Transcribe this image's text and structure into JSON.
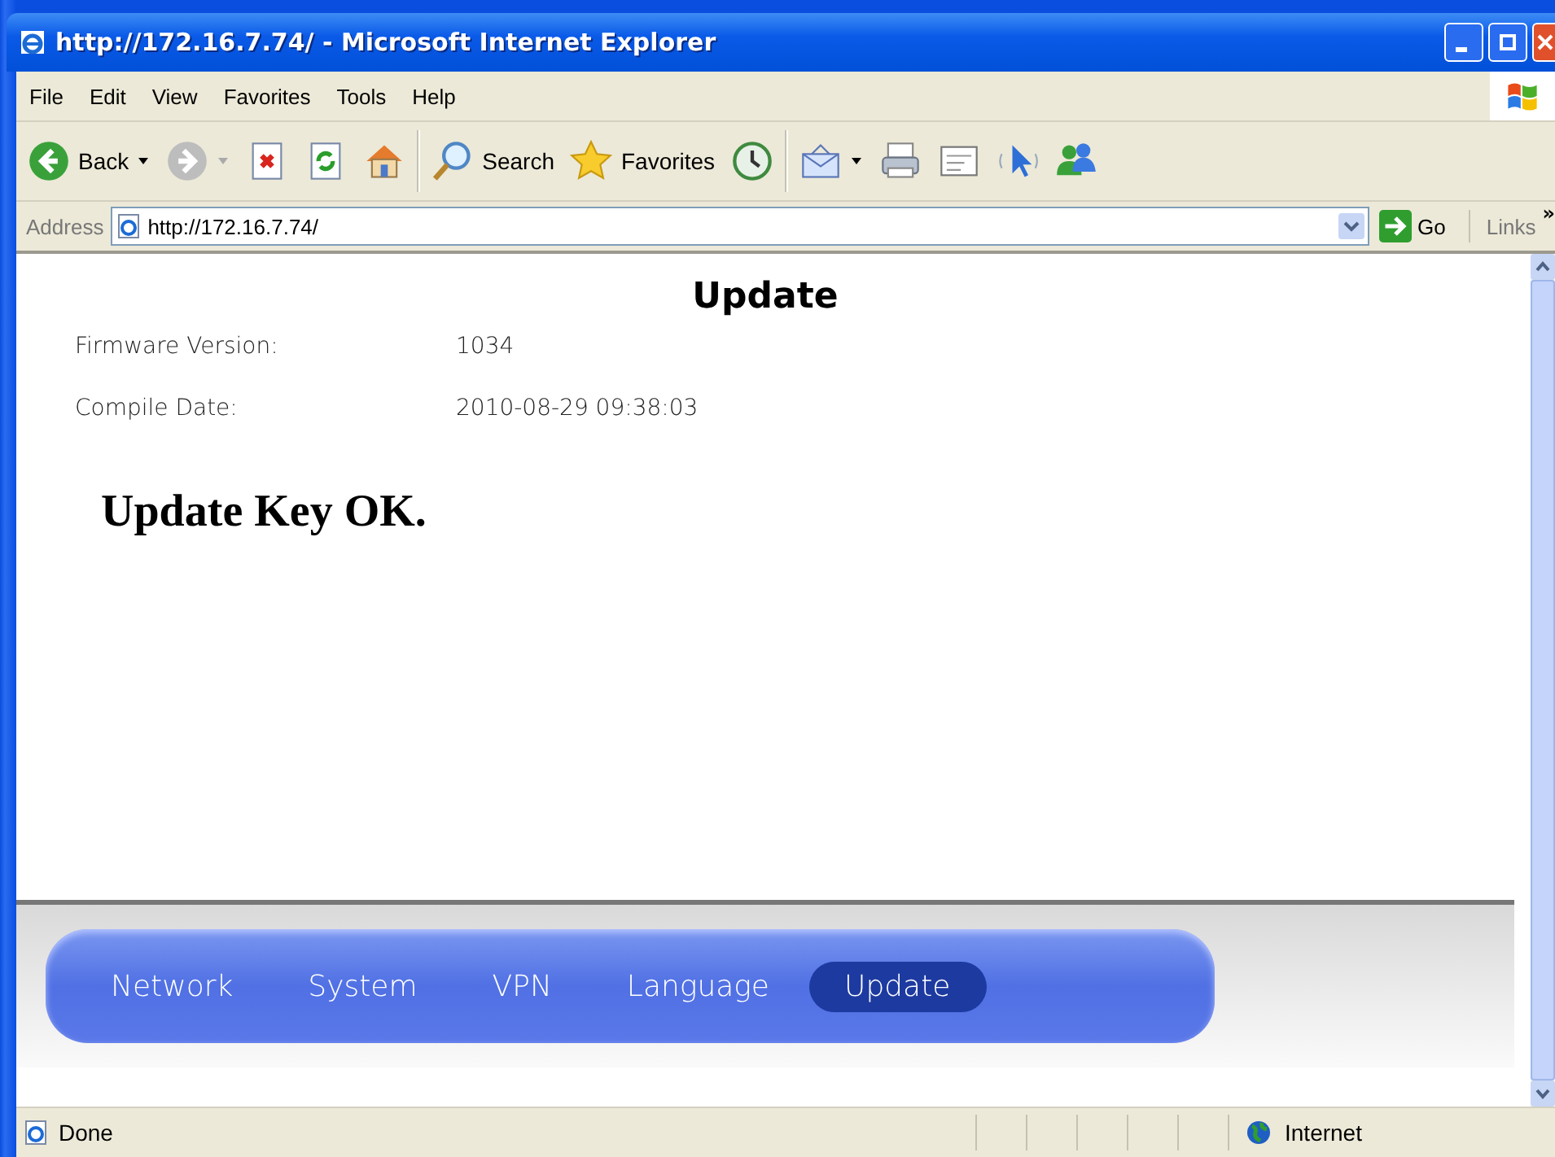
{
  "window": {
    "title": "http://172.16.7.74/ - Microsoft Internet Explorer"
  },
  "menu": [
    "File",
    "Edit",
    "View",
    "Favorites",
    "Tools",
    "Help"
  ],
  "toolbar": [
    {
      "kind": "back",
      "label": "Back"
    },
    {
      "kind": "forward"
    },
    {
      "kind": "stop"
    },
    {
      "kind": "refresh"
    },
    {
      "kind": "home"
    },
    {
      "kind": "search",
      "label": "Search"
    },
    {
      "kind": "favorites",
      "label": "Favorites"
    },
    {
      "kind": "history"
    },
    {
      "kind": "mail"
    },
    {
      "kind": "print"
    },
    {
      "kind": "edit"
    },
    {
      "kind": "discuss"
    },
    {
      "kind": "messenger"
    }
  ],
  "address": {
    "label": "Address",
    "value": "http://172.16.7.74/",
    "go": "Go",
    "links": "Links",
    "more": "»"
  },
  "page": {
    "heading": "Update",
    "info": [
      {
        "label": "Firmware Version:",
        "value": "1034"
      },
      {
        "label": "Compile Date:",
        "value": "2010-08-29 09:38:03"
      }
    ],
    "message": "Update Key OK.",
    "nav": [
      {
        "label": "Network",
        "selected": false
      },
      {
        "label": "System",
        "selected": false
      },
      {
        "label": "VPN",
        "selected": false
      },
      {
        "label": "Language",
        "selected": false
      },
      {
        "label": "Update",
        "selected": true
      }
    ]
  },
  "status_bar": {
    "text": "Done",
    "zone": "Internet"
  }
}
